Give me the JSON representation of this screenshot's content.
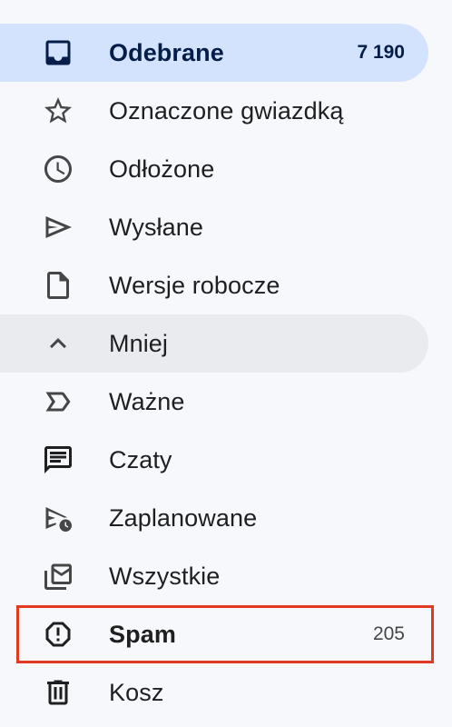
{
  "colors": {
    "background": "#f6f8fc",
    "selected_bg": "#d3e3fd",
    "selected_text": "#041e49",
    "less_bg": "#e9ebef",
    "highlight_border": "#e23a22",
    "icon": "#444746"
  },
  "sidebar": {
    "items": [
      {
        "label": "Odebrane",
        "count": "7 190",
        "icon": "inbox-icon",
        "selected": true
      },
      {
        "label": "Oznaczone gwiazdką",
        "icon": "star-icon"
      },
      {
        "label": "Odłożone",
        "icon": "clock-icon"
      },
      {
        "label": "Wysłane",
        "icon": "send-icon"
      },
      {
        "label": "Wersje robocze",
        "icon": "draft-icon"
      },
      {
        "label": "Mniej",
        "icon": "chevron-up-icon"
      },
      {
        "label": "Ważne",
        "icon": "label-important-icon"
      },
      {
        "label": "Czaty",
        "icon": "chat-icon"
      },
      {
        "label": "Zaplanowane",
        "icon": "schedule-send-icon"
      },
      {
        "label": "Wszystkie",
        "icon": "all-mail-icon"
      },
      {
        "label": "Spam",
        "count": "205",
        "icon": "report-icon",
        "highlighted": true
      },
      {
        "label": "Kosz",
        "icon": "trash-icon"
      }
    ]
  }
}
